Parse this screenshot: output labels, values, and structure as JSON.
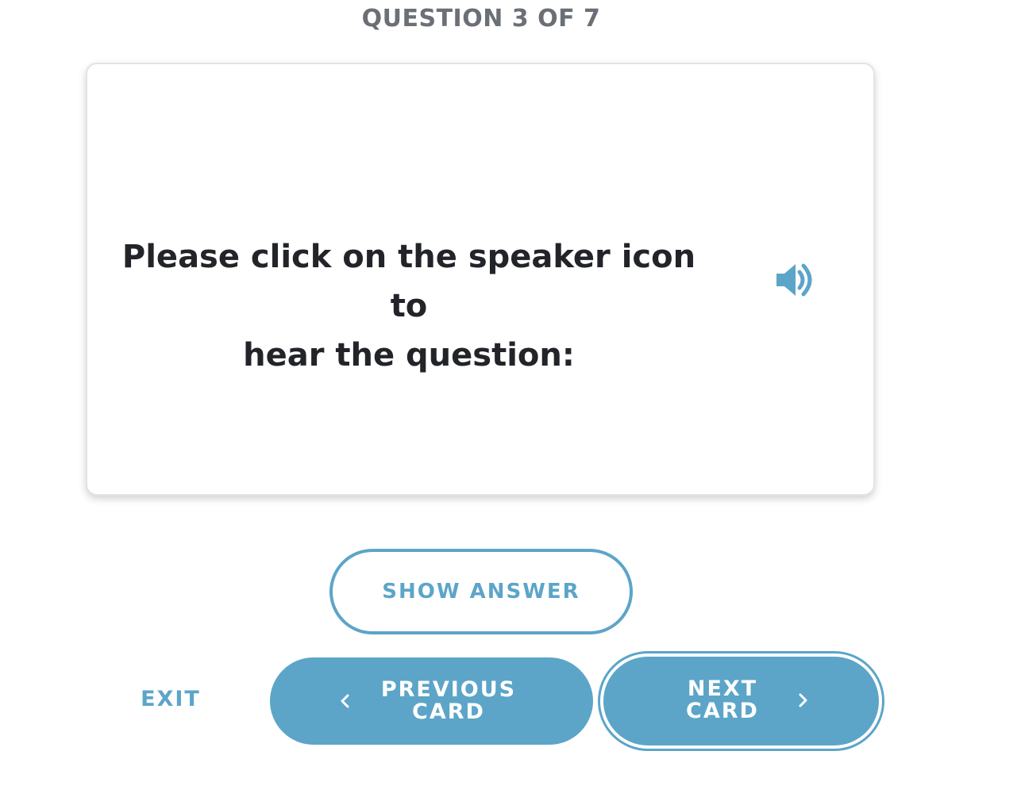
{
  "progress": {
    "label": "QUESTION 3 OF 7"
  },
  "card": {
    "question_line1": "Please click on the speaker icon to",
    "question_line2": "hear the question:",
    "speaker_icon": "speaker-icon"
  },
  "actions": {
    "show_answer": "SHOW ANSWER",
    "exit": "EXIT",
    "previous_line1": "PREVIOUS",
    "previous_line2": "CARD",
    "next_line1": "NEXT",
    "next_line2": "CARD"
  },
  "colors": {
    "accent": "#5ca5c8",
    "text": "#222429",
    "muted": "#6b6f76"
  }
}
